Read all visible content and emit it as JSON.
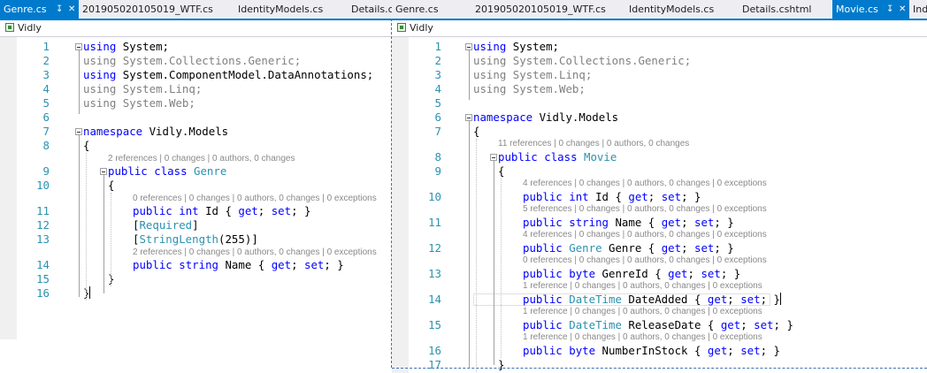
{
  "left": {
    "tabs": [
      {
        "label": "Genre.cs",
        "active": true
      },
      {
        "label": "201905020105019_WTF.cs",
        "active": false
      },
      {
        "label": "IdentityModels.cs",
        "active": false
      },
      {
        "label": "Details.cs",
        "active": false
      }
    ],
    "nav_project": "Vidly",
    "lines": [
      {
        "n": "1",
        "code": "using System;",
        "kind": "using-active"
      },
      {
        "n": "2",
        "code": "using System.Collections.Generic;",
        "kind": "using-dim"
      },
      {
        "n": "3",
        "code": "using System.ComponentModel.DataAnnotations;",
        "kind": "using-active"
      },
      {
        "n": "4",
        "code": "using System.Linq;",
        "kind": "using-dim"
      },
      {
        "n": "5",
        "code": "using System.Web;",
        "kind": "using-dim"
      },
      {
        "n": "6",
        "code": "",
        "kind": "blank"
      },
      {
        "n": "7",
        "code": "namespace Vidly.Models",
        "kind": "namespace"
      },
      {
        "n": "8",
        "code": "{",
        "kind": "brace"
      },
      {
        "n": "9",
        "lens": "2 references | 0 changes | 0 authors, 0 changes",
        "code": "public class Genre",
        "kind": "class"
      },
      {
        "n": "10",
        "code": "{",
        "kind": "brace2"
      },
      {
        "n": "11",
        "lens": "0 references | 0 changes | 0 authors, 0 changes | 0 exceptions",
        "code": "public int Id { get; set; }",
        "kind": "prop"
      },
      {
        "n": "12",
        "code": "[Required]",
        "kind": "attr"
      },
      {
        "n": "13",
        "code": "[StringLength(255)]",
        "kind": "attr-arg"
      },
      {
        "n": "14",
        "lens": "2 references | 0 changes | 0 authors, 0 changes | 0 exceptions",
        "code": "public string Name { get; set; }",
        "kind": "prop"
      },
      {
        "n": "15",
        "code": "}",
        "kind": "brace2"
      },
      {
        "n": "16",
        "code": "}",
        "kind": "brace-cursor"
      }
    ]
  },
  "right": {
    "tabs": [
      {
        "label": "Genre.cs",
        "active": false
      },
      {
        "label": "201905020105019_WTF.cs",
        "active": false
      },
      {
        "label": "IdentityModels.cs",
        "active": false
      },
      {
        "label": "Details.cshtml",
        "active": false
      },
      {
        "label": "Movie.cs",
        "active": true
      },
      {
        "label": "Ind",
        "active": false
      }
    ],
    "nav_project": "Vidly",
    "lines": [
      {
        "n": "1",
        "code": "using System;",
        "kind": "using-active"
      },
      {
        "n": "2",
        "code": "using System.Collections.Generic;",
        "kind": "using-dim"
      },
      {
        "n": "3",
        "code": "using System.Linq;",
        "kind": "using-dim"
      },
      {
        "n": "4",
        "code": "using System.Web;",
        "kind": "using-dim"
      },
      {
        "n": "5",
        "code": "",
        "kind": "blank"
      },
      {
        "n": "6",
        "code": "namespace Vidly.Models",
        "kind": "namespace"
      },
      {
        "n": "7",
        "code": "{",
        "kind": "brace"
      },
      {
        "n": "8",
        "lens": "11 references | 0 changes | 0 authors, 0 changes",
        "code": "public class Movie",
        "kind": "class"
      },
      {
        "n": "9",
        "code": "{",
        "kind": "brace2"
      },
      {
        "n": "10",
        "lens": "4 references | 0 changes | 0 authors, 0 changes | 0 exceptions",
        "code": "public int Id { get; set; }",
        "kind": "prop"
      },
      {
        "n": "11",
        "lens": "5 references | 0 changes | 0 authors, 0 changes | 0 exceptions",
        "code": "public string Name { get; set; }",
        "kind": "prop"
      },
      {
        "n": "12",
        "lens": "4 references | 0 changes | 0 authors, 0 changes | 0 exceptions",
        "code": "public Genre Genre { get; set; }",
        "kind": "prop-type"
      },
      {
        "n": "13",
        "lens": "0 references | 0 changes | 0 authors, 0 changes | 0 exceptions",
        "code": "public byte GenreId { get; set; }",
        "kind": "prop"
      },
      {
        "n": "14",
        "lens": "1 reference | 0 changes | 0 authors, 0 changes | 0 exceptions",
        "code": "public DateTime DateAdded { get; set; }",
        "kind": "prop-type-cursor"
      },
      {
        "n": "15",
        "lens": "1 reference | 0 changes | 0 authors, 0 changes | 0 exceptions",
        "code": "public DateTime ReleaseDate { get; set; }",
        "kind": "prop-type"
      },
      {
        "n": "16",
        "lens": "1 reference | 0 changes | 0 authors, 0 changes | 0 exceptions",
        "code": "public byte NumberInStock { get; set; }",
        "kind": "prop"
      },
      {
        "n": "17",
        "code": "}",
        "kind": "brace2"
      }
    ]
  },
  "colors": {
    "accent": "#007acc",
    "keyword": "#0000ff",
    "type": "#2b91af",
    "line_number": "#2b91af"
  }
}
